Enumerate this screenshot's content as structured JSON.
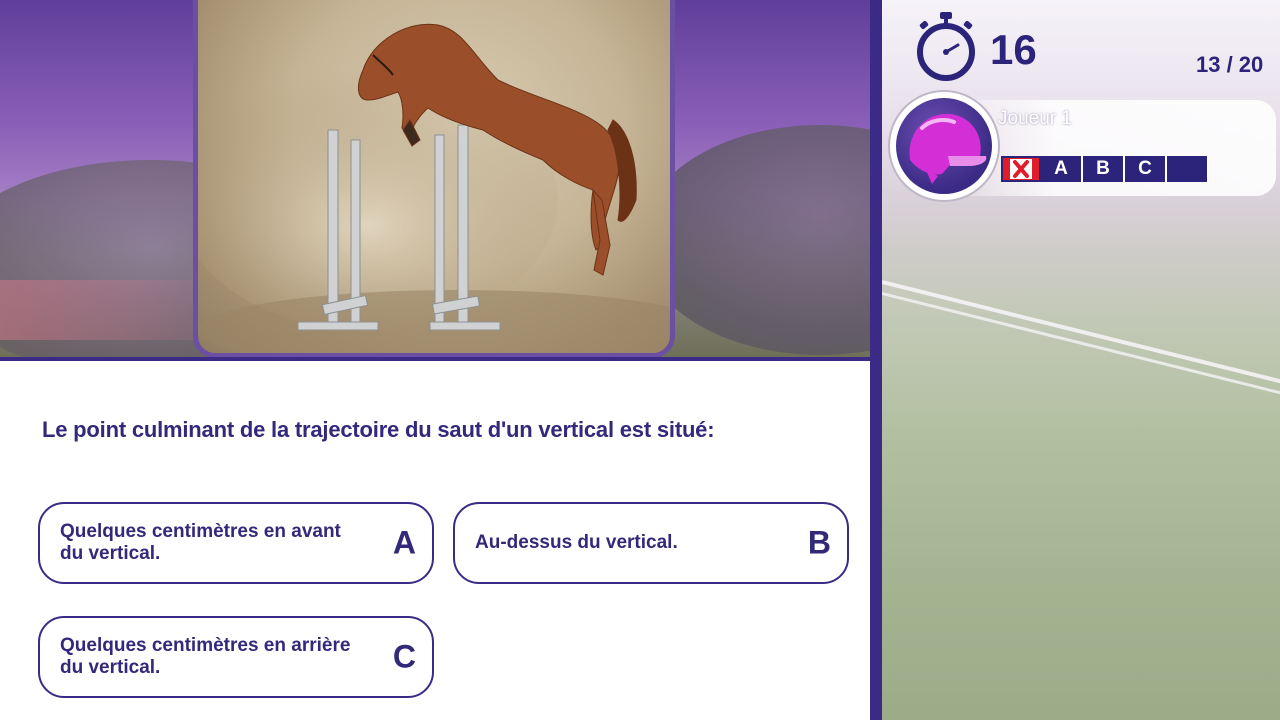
{
  "question": {
    "text": "Le point culminant de la trajectoire du saut d'un vertical est situé:",
    "image_subject": "horse-jumping-photo"
  },
  "answers": [
    {
      "text": "Quelques centimètres en avant du vertical.",
      "letter": "A"
    },
    {
      "text": "Au-dessus du vertical.",
      "letter": "B"
    },
    {
      "text": "Quelques centimètres en arrière du vertical.",
      "letter": "C"
    }
  ],
  "hud": {
    "timer_value": "16",
    "progress": "13 / 20"
  },
  "player": {
    "name": "Joueur 1",
    "answer_slots": [
      {
        "icon": "wrong-x-icon"
      },
      {
        "label": "A"
      },
      {
        "label": "B"
      },
      {
        "label": "C"
      },
      {
        "label": ""
      }
    ]
  },
  "colors": {
    "primary": "#33297a",
    "frame": "#3b2a86",
    "wrong": "#e11d2a",
    "helmet": "#d42fd6"
  }
}
